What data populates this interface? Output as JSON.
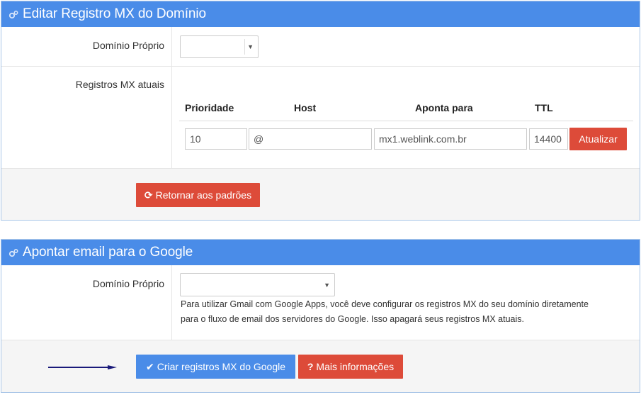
{
  "panel_mx": {
    "title": "Editar Registro MX do Domínio",
    "domain_label": "Domínio Próprio",
    "domain_value": "",
    "records_label": "Registros MX atuais",
    "columns": [
      "Prioridade",
      "Host",
      "Aponta para",
      "TTL"
    ],
    "record": {
      "priority": "10",
      "host": "@",
      "points_to": "mx1.weblink.com.br",
      "ttl": "14400"
    },
    "update_button": "Atualizar",
    "reset_button": "Retornar aos padrões"
  },
  "panel_google": {
    "title": "Apontar email para o Google",
    "domain_label": "Domínio Próprio",
    "domain_value": "",
    "help_line1": "Para utilizar Gmail com Google Apps, você deve configurar os registros MX do seu domínio diretamente",
    "help_line2": "para o fluxo de email dos servidores do Google. Isso apagará seus registros MX atuais.",
    "create_button": "Criar registros MX do Google",
    "more_info_button": "Mais informações"
  },
  "colors": {
    "header": "#4a8ce8",
    "danger": "#dd4b39",
    "primary": "#4a8ce8",
    "arrow": "#1a1a7a"
  }
}
